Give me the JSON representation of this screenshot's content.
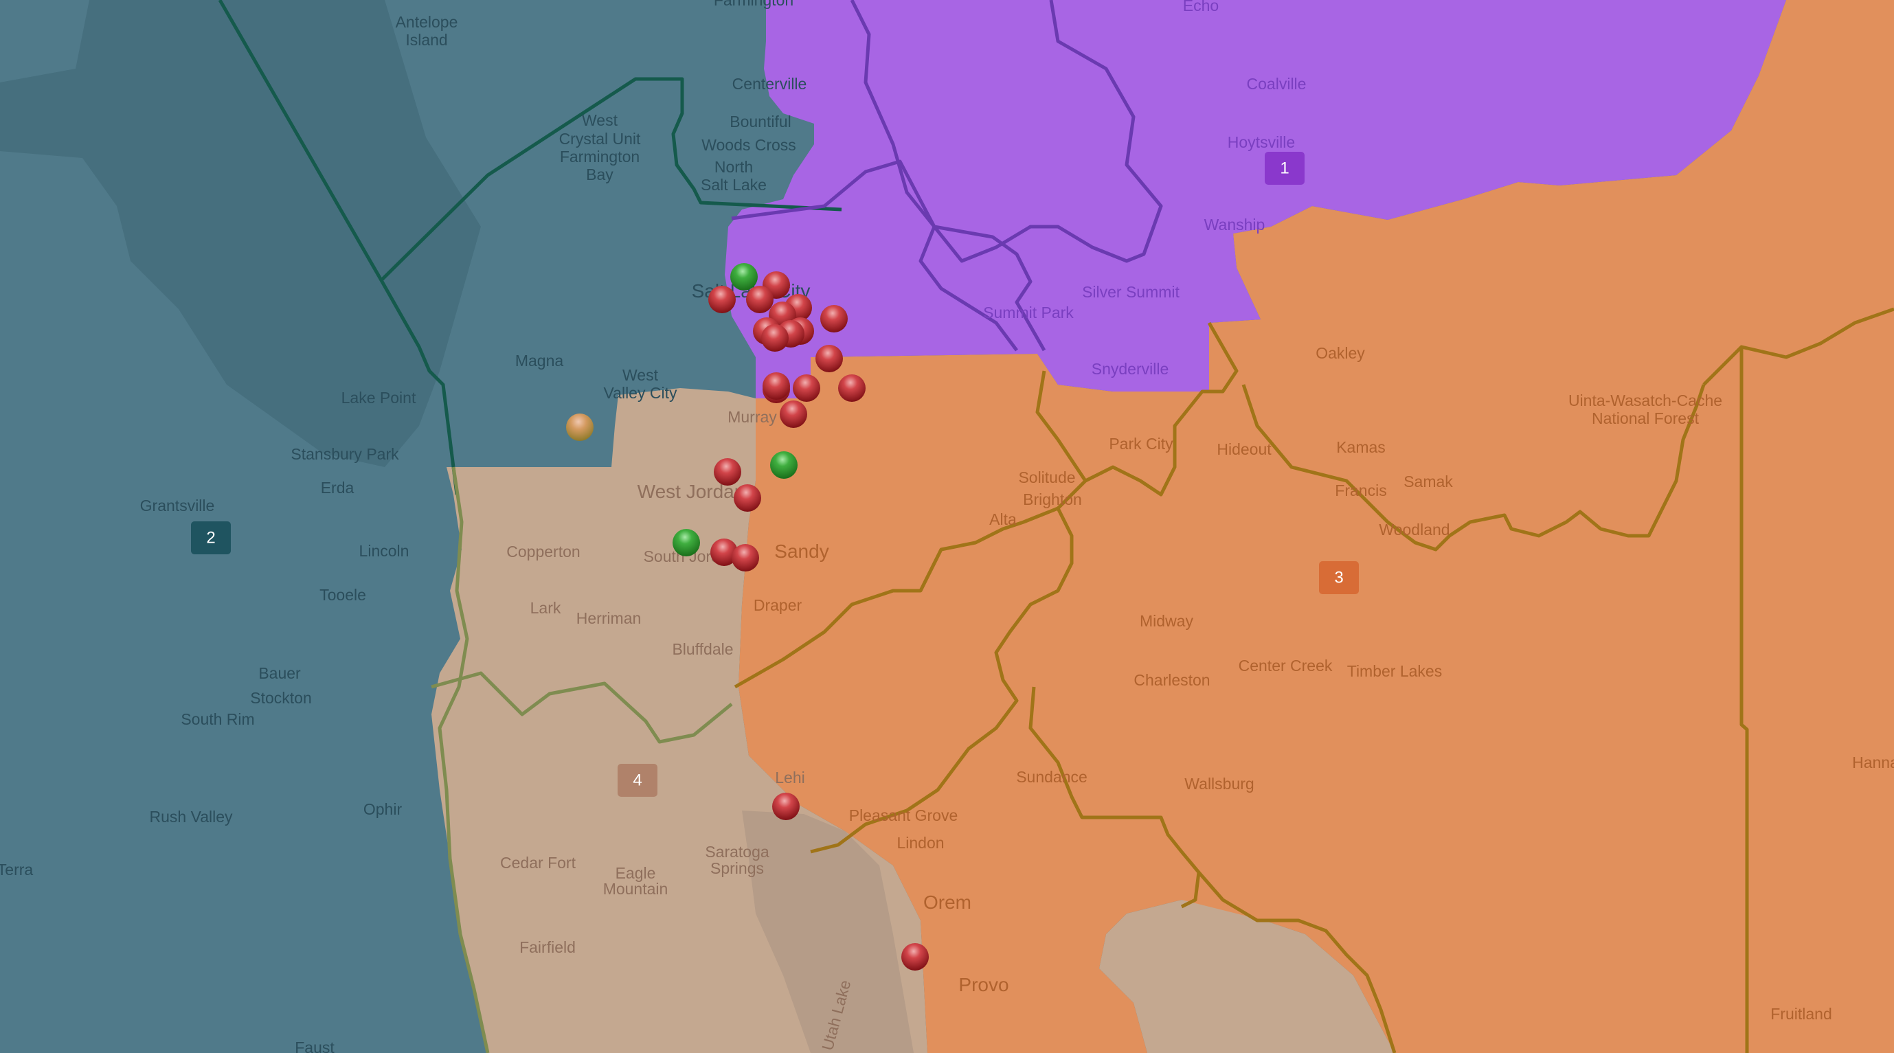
{
  "map": {
    "colors": {
      "district_1": "#a865e4",
      "district_2": "#507a8a",
      "district_3": "#e1905c",
      "district_4": "#c4a890",
      "lake": "#b59c88",
      "border_1": "#6a3ab0",
      "border_2": "#155a4c",
      "border_3": "#a07418",
      "border_4": "#7f8c50",
      "marker_red": "#c0272d",
      "marker_green": "#2a9a2a",
      "marker_tan": "#c9944f"
    },
    "districts": [
      {
        "id": "1",
        "label": "1",
        "badge_color": "#8a38cc"
      },
      {
        "id": "2",
        "label": "2",
        "badge_color": "#1f5460"
      },
      {
        "id": "3",
        "label": "3",
        "badge_color": "#d86c36"
      },
      {
        "id": "4",
        "label": "4",
        "badge_color": "#b0826a"
      }
    ],
    "places": [
      {
        "name": "Farmington",
        "district": "2"
      },
      {
        "name": "Antelope",
        "district": "2"
      },
      {
        "name": "Island",
        "district": "2"
      },
      {
        "name": "Echo",
        "district": "1"
      },
      {
        "name": "Centerville",
        "district": "2"
      },
      {
        "name": "Coalville",
        "district": "1"
      },
      {
        "name": "West",
        "district": "2"
      },
      {
        "name": "Crystal Unit",
        "district": "2"
      },
      {
        "name": "Farmington",
        "district": "2"
      },
      {
        "name": "Bay",
        "district": "2"
      },
      {
        "name": "Bountiful",
        "district": "2"
      },
      {
        "name": "Woods Cross",
        "district": "2"
      },
      {
        "name": "North",
        "district": "2"
      },
      {
        "name": "Salt Lake",
        "district": "2"
      },
      {
        "name": "Hoytsville",
        "district": "1"
      },
      {
        "name": "Wanship",
        "district": "1"
      },
      {
        "name": "Salt Lake City",
        "district": "2"
      },
      {
        "name": "Silver Summit",
        "district": "1"
      },
      {
        "name": "Summit Park",
        "district": "1"
      },
      {
        "name": "Magna",
        "district": "2"
      },
      {
        "name": "West",
        "district": "2"
      },
      {
        "name": "Valley City",
        "district": "2"
      },
      {
        "name": "Oakley",
        "district": "3"
      },
      {
        "name": "Snyderville",
        "district": "1"
      },
      {
        "name": "Lake Point",
        "district": "2"
      },
      {
        "name": "Murray",
        "district": "4"
      },
      {
        "name": "Uinta-Wasatch-Cache",
        "district": "3"
      },
      {
        "name": "National Forest",
        "district": "3"
      },
      {
        "name": "Park City",
        "district": "3"
      },
      {
        "name": "Hideout",
        "district": "3"
      },
      {
        "name": "Kamas",
        "district": "3"
      },
      {
        "name": "Stansbury Park",
        "district": "2"
      },
      {
        "name": "Solitude",
        "district": "3"
      },
      {
        "name": "Brighton",
        "district": "3"
      },
      {
        "name": "Samak",
        "district": "3"
      },
      {
        "name": "Erda",
        "district": "2"
      },
      {
        "name": "West Jordan",
        "district": "4"
      },
      {
        "name": "Francis",
        "district": "3"
      },
      {
        "name": "Grantsville",
        "district": "2"
      },
      {
        "name": "Alta",
        "district": "3"
      },
      {
        "name": "Woodland",
        "district": "3"
      },
      {
        "name": "Lincoln",
        "district": "2"
      },
      {
        "name": "Copperton",
        "district": "4"
      },
      {
        "name": "South Jordan",
        "district": "4"
      },
      {
        "name": "Sandy",
        "district": "3"
      },
      {
        "name": "Tooele",
        "district": "2"
      },
      {
        "name": "Draper",
        "district": "3"
      },
      {
        "name": "Lark",
        "district": "4"
      },
      {
        "name": "Herriman",
        "district": "4"
      },
      {
        "name": "Midway",
        "district": "3"
      },
      {
        "name": "Bluffdale",
        "district": "4"
      },
      {
        "name": "Center Creek",
        "district": "3"
      },
      {
        "name": "Timber Lakes",
        "district": "3"
      },
      {
        "name": "Bauer",
        "district": "2"
      },
      {
        "name": "Charleston",
        "district": "3"
      },
      {
        "name": "Stockton",
        "district": "2"
      },
      {
        "name": "South Rim",
        "district": "2"
      },
      {
        "name": "Hanna",
        "district": "3"
      },
      {
        "name": "Lehi",
        "district": "4"
      },
      {
        "name": "Sundance",
        "district": "3"
      },
      {
        "name": "Wallsburg",
        "district": "3"
      },
      {
        "name": "Pleasant Grove",
        "district": "3"
      },
      {
        "name": "Ophir",
        "district": "2"
      },
      {
        "name": "Rush Valley",
        "district": "2"
      },
      {
        "name": "Lindon",
        "district": "3"
      },
      {
        "name": "Cedar Fort",
        "district": "4"
      },
      {
        "name": "Terra",
        "district": "2"
      },
      {
        "name": "Eagle",
        "district": "4"
      },
      {
        "name": "Mountain",
        "district": "4"
      },
      {
        "name": "Saratoga",
        "district": "4"
      },
      {
        "name": "Springs",
        "district": "4"
      },
      {
        "name": "Orem",
        "district": "3"
      },
      {
        "name": "Fairfield",
        "district": "4"
      },
      {
        "name": "Provo",
        "district": "3"
      },
      {
        "name": "Utah Lake",
        "district": "4"
      },
      {
        "name": "Fruitland",
        "district": "3"
      },
      {
        "name": "Faust",
        "district": "2"
      }
    ],
    "markers": [
      {
        "status": "green"
      },
      {
        "status": "red"
      },
      {
        "status": "red"
      },
      {
        "status": "red"
      },
      {
        "status": "red"
      },
      {
        "status": "red"
      },
      {
        "status": "red"
      },
      {
        "status": "red"
      },
      {
        "status": "red"
      },
      {
        "status": "red"
      },
      {
        "status": "red"
      },
      {
        "status": "red"
      },
      {
        "status": "red"
      },
      {
        "status": "red"
      },
      {
        "status": "red"
      },
      {
        "status": "red"
      },
      {
        "status": "red"
      },
      {
        "status": "tan"
      },
      {
        "status": "green"
      },
      {
        "status": "red"
      },
      {
        "status": "red"
      },
      {
        "status": "green"
      },
      {
        "status": "red"
      },
      {
        "status": "red"
      },
      {
        "status": "red"
      },
      {
        "status": "red"
      }
    ]
  }
}
